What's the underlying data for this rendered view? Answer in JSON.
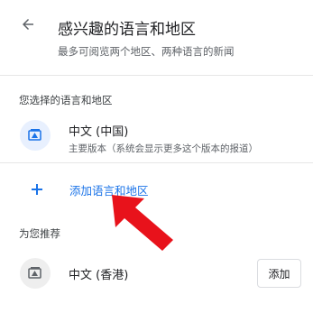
{
  "header": {
    "title": "感兴趣的语言和地区",
    "subtitle": "最多可阅览两个地区、两种语言的新闻",
    "back_icon": "arrow-left-icon"
  },
  "selected_section": {
    "label": "您选择的语言和地区",
    "items": [
      {
        "name": "中文 (中国)",
        "description": "主要版本（系统会显示更多这个版本的报道）",
        "icon": "translate-icon"
      }
    ]
  },
  "add_language": {
    "label": "添加语言和地区",
    "icon": "plus-icon"
  },
  "suggested_section": {
    "label": "为您推荐",
    "items": [
      {
        "name": "中文 (香港)",
        "button_label": "添加",
        "icon": "translate-icon"
      }
    ]
  },
  "colors": {
    "accent": "#1a73e8",
    "annotation_arrow": "#e8121b"
  }
}
